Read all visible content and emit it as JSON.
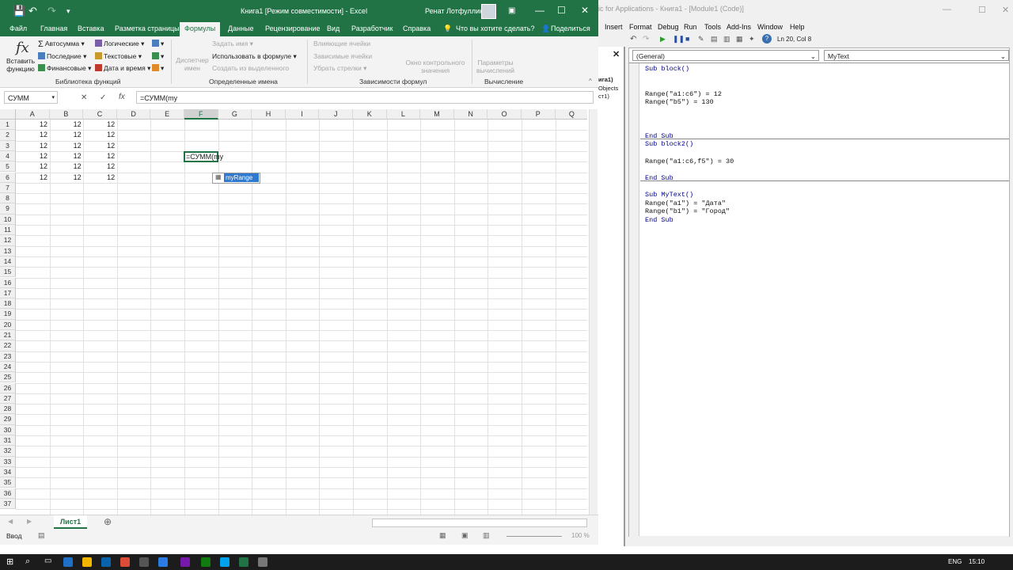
{
  "excel": {
    "title": "Книга1  [Режим совместимости]  -  Excel",
    "user": "Ренат Лотфуллин",
    "tabs": [
      "Файл",
      "Главная",
      "Вставка",
      "Разметка страницы",
      "Формулы",
      "Данные",
      "Рецензирование",
      "Вид",
      "Разработчик",
      "Справка",
      "Что вы хотите сделать?",
      "Поделиться"
    ],
    "active_tab": "Формулы",
    "ribbon": {
      "insert_function": "Вставить функцию",
      "autosum": "Автосумма",
      "recent": "Последние",
      "financial": "Финансовые",
      "logical": "Логические",
      "text": "Текстовые",
      "datetime": "Дата и время",
      "group_library": "Библиотека функций",
      "name_manager": "Диспетчер имен",
      "assign_name": "Задать имя",
      "use_in_formula": "Использовать в формуле",
      "create_from_selection": "Создать из выделенного",
      "group_names": "Определенные имена",
      "trace_precedents": "Влияющие ячейки",
      "trace_dependents": "Зависимые ячейки",
      "remove_arrows": "Убрать стрелки",
      "watch_window": "Окно контрольного значения",
      "group_audit": "Зависимости формул",
      "calc_options": "Параметры вычислений",
      "group_calc": "Вычисление"
    },
    "name_box": "СУММ",
    "formula": "=СУММ(my",
    "columns": [
      "A",
      "B",
      "C",
      "D",
      "E",
      "F",
      "G",
      "H",
      "I",
      "J",
      "K",
      "L",
      "M",
      "N",
      "O",
      "P",
      "Q"
    ],
    "rows": [
      "1",
      "2",
      "3",
      "4",
      "5",
      "6",
      "7",
      "8",
      "9",
      "10",
      "11",
      "12",
      "13",
      "14",
      "15",
      "16",
      "17",
      "18",
      "19",
      "20",
      "21",
      "22",
      "23",
      "24",
      "25",
      "26",
      "27",
      "28",
      "29",
      "30",
      "31",
      "32",
      "33",
      "34",
      "35",
      "36",
      "37"
    ],
    "data_rows": [
      [
        "12",
        "12",
        "12"
      ],
      [
        "12",
        "12",
        "12"
      ],
      [
        "12",
        "12",
        "12"
      ],
      [
        "12",
        "12",
        "12"
      ],
      [
        "12",
        "12",
        "12"
      ],
      [
        "12",
        "12",
        "12"
      ]
    ],
    "active_cell_text": "=СУММ(my",
    "autocomplete_item": "myRange",
    "sheet_tab": "Лист1",
    "status": "Ввод",
    "zoom": "100 %"
  },
  "vba": {
    "title": "ic for Applications - Книга1 - [Module1 (Code)]",
    "menus": [
      "Insert",
      "Format",
      "Debug",
      "Run",
      "Tools",
      "Add-Ins",
      "Window",
      "Help"
    ],
    "position": "Ln 20, Col 8",
    "object_combo": "(General)",
    "proc_combo": "MyText",
    "project_fragment": [
      "ига1)",
      "Objects",
      "ст1)"
    ],
    "code": [
      "Sub block()",
      "",
      "",
      "Range(\"a1:c6\") = 12",
      "Range(\"b5\") = 130",
      "",
      "",
      "",
      "End Sub",
      "Sub block2()",
      "",
      "Range(\"a1:c6,f5\") = 30",
      "",
      "End Sub",
      "",
      "Sub MyText()",
      "Range(\"a1\") = \"Дата\"",
      "Range(\"b1\") = \"Город\"",
      "End Sub"
    ]
  },
  "taskbar": {
    "lang": "ENG",
    "time": "15:10"
  },
  "colors": {
    "excel_green": "#217346",
    "selection_blue": "#2f7ad0",
    "vba_keyword": "#00008b"
  }
}
